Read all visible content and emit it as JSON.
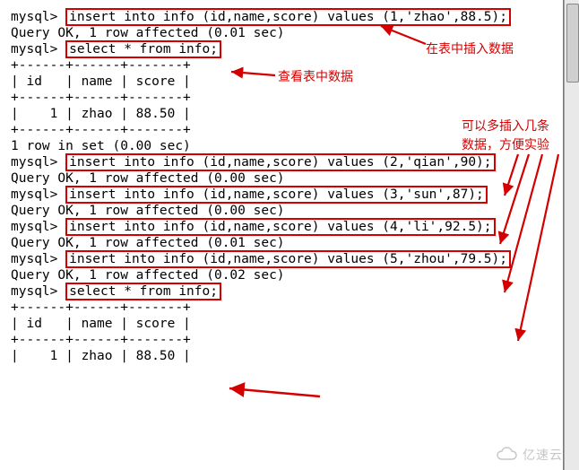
{
  "prompt": "mysql> ",
  "sql": {
    "insert1": "insert into info (id,name,score) values (1,'zhao',88.5);",
    "insert2": "insert into info (id,name,score) values (2,'qian',90);",
    "insert3": "insert into info (id,name,score) values (3,'sun',87);",
    "insert4": "insert into info (id,name,score) values (4,'li',92.5);",
    "insert5": "insert into info (id,name,score) values (5,'zhou',79.5);",
    "select1": "select * from info;",
    "select2": "select * from info;"
  },
  "output": {
    "ok001a": "Query OK, 1 row affected (0.01 sec)",
    "ok000a": "Query OK, 1 row affected (0.00 sec)",
    "ok000b": "Query OK, 1 row affected (0.00 sec)",
    "ok001b": "Query OK, 1 row affected (0.01 sec)",
    "ok002": "Query OK, 1 row affected (0.02 sec)",
    "sep": "+------+------+-------+",
    "hdr": "| id   | name | score |",
    "row1": "|    1 | zhao | 88.50 |",
    "rowset": "1 row in set (0.00 sec)",
    "blank": ""
  },
  "annotations": {
    "a1": "在表中插入数据",
    "a2": "查看表中数据",
    "a3_line1": "可以多插入几条",
    "a3_line2": "数据，方便实验"
  },
  "watermark": "亿速云"
}
